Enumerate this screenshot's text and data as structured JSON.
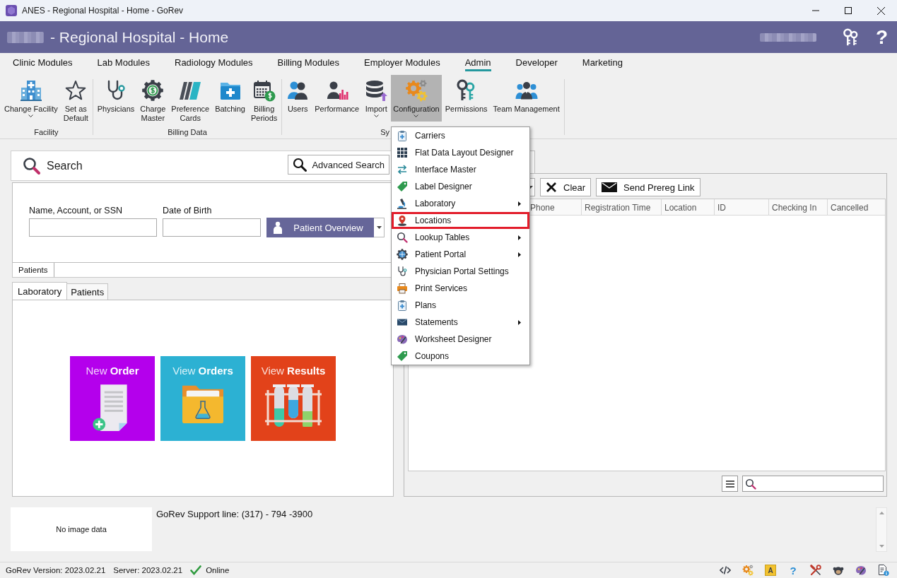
{
  "window": {
    "title": "ANES - Regional Hospital - Home - GoRev"
  },
  "header": {
    "title": "- Regional Hospital - Home",
    "help": "?"
  },
  "ribbon": {
    "tabs": [
      {
        "label": "Clinic Modules",
        "selected": false
      },
      {
        "label": "Lab Modules",
        "selected": false
      },
      {
        "label": "Radiology Modules",
        "selected": false
      },
      {
        "label": "Billing Modules",
        "selected": false
      },
      {
        "label": "Employer Modules",
        "selected": false
      },
      {
        "label": "Admin",
        "selected": true
      },
      {
        "label": "Developer",
        "selected": false
      },
      {
        "label": "Marketing",
        "selected": false
      }
    ],
    "groups": [
      {
        "label": "Facility",
        "label_covered": false,
        "buttons": [
          {
            "label": "Change Facility",
            "dropdown": true,
            "pressed": false
          },
          {
            "label": "Set as\nDefault",
            "dropdown": false,
            "pressed": false
          }
        ]
      },
      {
        "label": "Billing Data",
        "label_covered": false,
        "buttons": [
          {
            "label": "Physicians",
            "dropdown": false,
            "pressed": false
          },
          {
            "label": "Charge\nMaster",
            "dropdown": false,
            "pressed": false
          },
          {
            "label": "Preference\nCards",
            "dropdown": false,
            "pressed": false
          },
          {
            "label": "Batching",
            "dropdown": false,
            "pressed": false
          },
          {
            "label": "Billing\nPeriods",
            "dropdown": false,
            "pressed": false
          }
        ]
      },
      {
        "label": "Sy",
        "label_covered": true,
        "buttons": [
          {
            "label": "Users",
            "dropdown": false,
            "pressed": false
          },
          {
            "label": "Performance",
            "dropdown": false,
            "pressed": false
          },
          {
            "label": "Import",
            "dropdown": true,
            "pressed": false
          },
          {
            "label": "Configuration",
            "dropdown": true,
            "pressed": true
          },
          {
            "label": "Permissions",
            "dropdown": false,
            "pressed": false
          },
          {
            "label": "Team Management",
            "dropdown": false,
            "pressed": false
          }
        ]
      }
    ]
  },
  "configuration_menu": {
    "items": [
      {
        "label": "Carriers",
        "submenu": false,
        "highlighted": false
      },
      {
        "label": "Flat Data Layout Designer",
        "submenu": false,
        "highlighted": false
      },
      {
        "label": "Interface Master",
        "submenu": false,
        "highlighted": false
      },
      {
        "label": "Label Designer",
        "submenu": false,
        "highlighted": false
      },
      {
        "label": "Laboratory",
        "submenu": true,
        "highlighted": false
      },
      {
        "label": "Locations",
        "submenu": false,
        "highlighted": true
      },
      {
        "label": "Lookup Tables",
        "submenu": true,
        "highlighted": false
      },
      {
        "label": "Patient Portal",
        "submenu": true,
        "highlighted": false
      },
      {
        "label": "Physician Portal Settings",
        "submenu": false,
        "highlighted": false
      },
      {
        "label": "Print Services",
        "submenu": false,
        "highlighted": false
      },
      {
        "label": "Plans",
        "submenu": false,
        "highlighted": false
      },
      {
        "label": "Statements",
        "submenu": true,
        "highlighted": false
      },
      {
        "label": "Worksheet Designer",
        "submenu": false,
        "highlighted": false
      },
      {
        "label": "Coupons",
        "submenu": false,
        "highlighted": false
      }
    ]
  },
  "search_panel": {
    "title": "Search",
    "advanced_button": "Advanced Search",
    "fields": [
      {
        "label": "Name, Account, or SSN"
      },
      {
        "label": "Date of Birth"
      }
    ],
    "overview_button": "Patient Overview",
    "result_tabs": [
      {
        "label": "Patients",
        "selected": true
      }
    ]
  },
  "module_tabs": [
    {
      "label": "Laboratory",
      "selected": true
    },
    {
      "label": "Patients",
      "selected": false
    }
  ],
  "tiles": [
    {
      "text": "New **Order**",
      "color": "#b400ec"
    },
    {
      "text": "View **Orders**",
      "color": "#2cb1d3"
    },
    {
      "text": "View **Results**",
      "color": "#e2421a"
    }
  ],
  "registrations": {
    "toolbar": [
      {
        "label": "Clear"
      },
      {
        "label": "Send Prereg Link"
      }
    ],
    "columns": [
      "Phone",
      "Registration Time",
      "Location",
      "ID",
      "Checking In",
      "Cancelled"
    ]
  },
  "footer": {
    "image_placeholder": "No image data",
    "support_line": "GoRev Support line: (317) - 794 -3900"
  },
  "status_bar": {
    "version": "GoRev Version: 2023.02.21",
    "server": "Server: 2023.02.21",
    "connection": {
      "label": "Online",
      "online": true
    },
    "icons": [
      {
        "kind": "code"
      },
      {
        "kind": "gears"
      },
      {
        "kind": "letter",
        "glyph": "A"
      },
      {
        "kind": "help",
        "glyph": "?"
      },
      {
        "kind": "tools"
      },
      {
        "kind": "bug"
      },
      {
        "kind": "palette"
      },
      {
        "kind": "document"
      }
    ]
  }
}
